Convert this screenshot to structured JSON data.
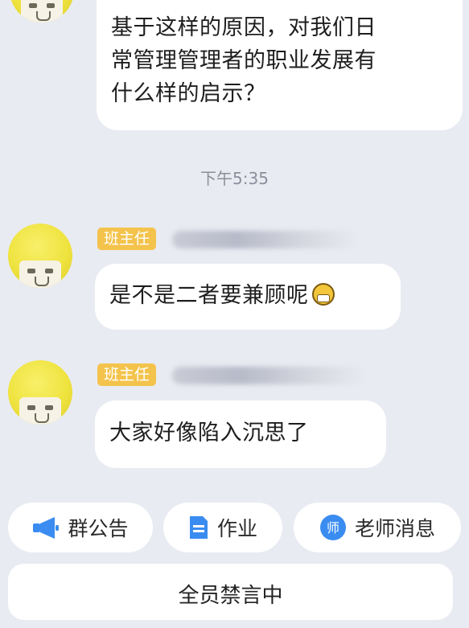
{
  "messages": [
    {
      "id": "msg1",
      "lines": [
        "基于这样的原因，对我们日",
        "常管理管理者的职业发展有",
        "什么样的启示？"
      ]
    },
    {
      "id": "msg2",
      "badge": "班主任",
      "text": "是不是二者要兼顾呢",
      "emoji": "grin-emoji"
    },
    {
      "id": "msg3",
      "badge": "班主任",
      "text": "大家好像陷入沉思了"
    }
  ],
  "timestamp": "下午5:35",
  "quick_actions": [
    {
      "label": "群公告",
      "icon": "megaphone-icon",
      "color": "#3a8cf0"
    },
    {
      "label": "作业",
      "icon": "document-icon",
      "color": "#3a8cf0"
    },
    {
      "label": "老师消息",
      "icon": "teacher-badge-icon",
      "icon_glyph": "师",
      "color": "#3a8cf0"
    }
  ],
  "status": {
    "muted_label": "全员禁言中"
  },
  "colors": {
    "background": "#e9ebf2",
    "bubble": "#ffffff",
    "badge": "#f4c34c",
    "accent": "#3a8cf0"
  }
}
